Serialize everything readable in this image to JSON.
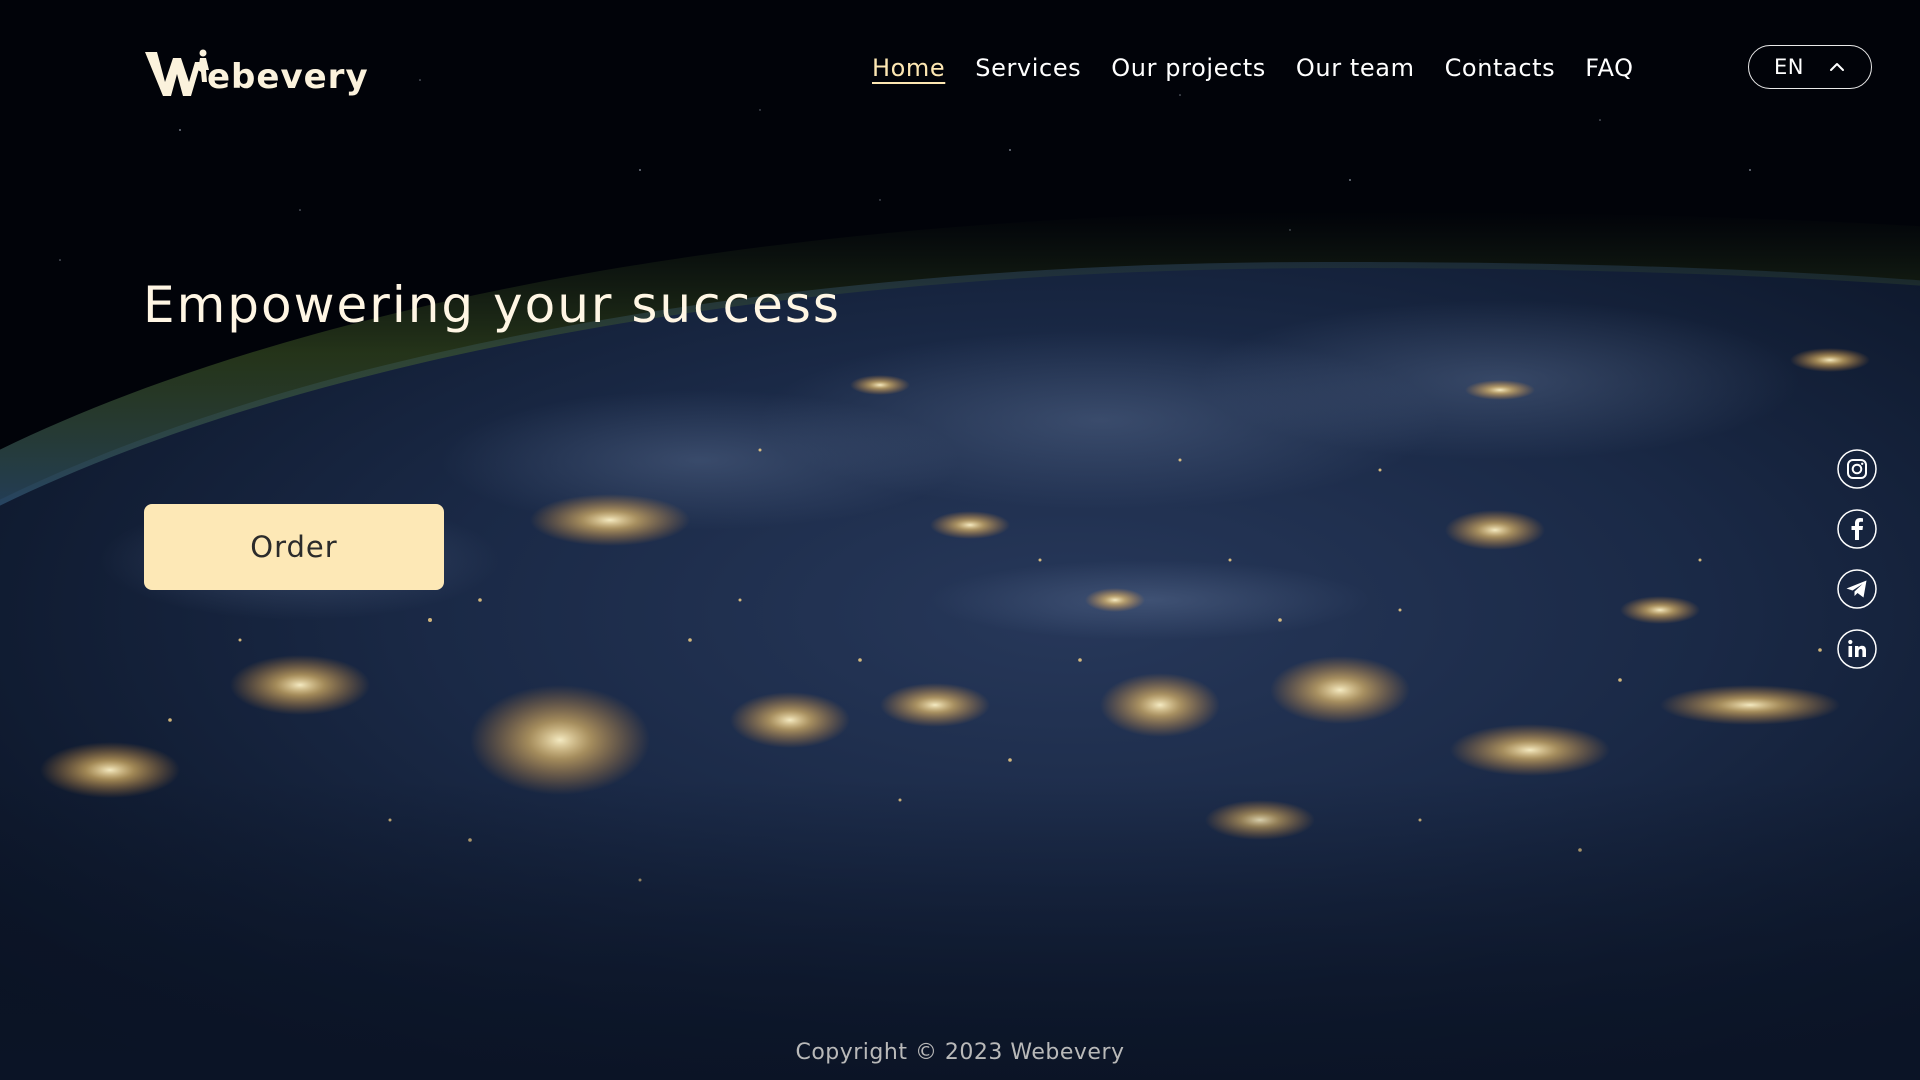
{
  "brand": {
    "name": "Webevery",
    "logo_text": "ebevery"
  },
  "nav": {
    "items": [
      {
        "label": "Home",
        "active": true
      },
      {
        "label": "Services",
        "active": false
      },
      {
        "label": "Our projects",
        "active": false
      },
      {
        "label": "Our team",
        "active": false
      },
      {
        "label": "Contacts",
        "active": false
      },
      {
        "label": "FAQ",
        "active": false
      }
    ]
  },
  "language": {
    "selected": "EN",
    "icon": "chevron-up-icon"
  },
  "hero": {
    "title": "Empowering your success",
    "cta_label": "Order"
  },
  "social": [
    {
      "name": "instagram",
      "icon": "instagram-icon"
    },
    {
      "name": "facebook",
      "icon": "facebook-icon"
    },
    {
      "name": "telegram",
      "icon": "telegram-icon"
    },
    {
      "name": "linkedin",
      "icon": "linkedin-icon"
    }
  ],
  "footer": {
    "copyright": "Copyright © 2023 Webevery"
  },
  "colors": {
    "accent": "#fde8b6",
    "active_nav": "#fde7b3",
    "text": "#ffffff",
    "background": "#02040a"
  }
}
